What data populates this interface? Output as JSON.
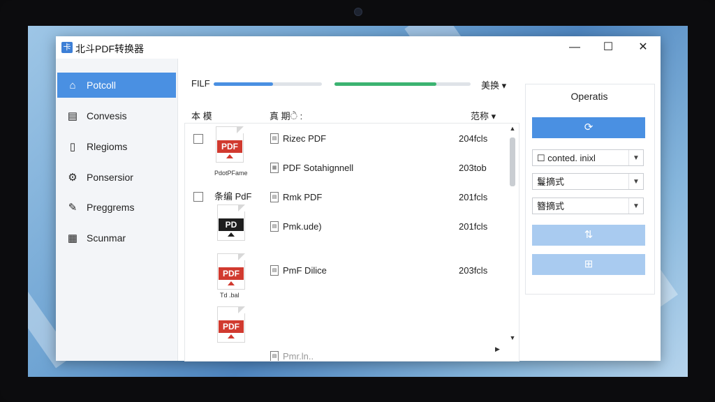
{
  "window": {
    "title": "北斗PDF转换器",
    "logo_glyph": "卡",
    "minimize": "—",
    "maximize": "☐",
    "close": "✕"
  },
  "sidebar": {
    "items": [
      {
        "label": "Potcoll",
        "icon": "home-icon",
        "active": true
      },
      {
        "label": "Convesis",
        "icon": "document-icon"
      },
      {
        "label": "Rlegioms",
        "icon": "file-icon"
      },
      {
        "label": "Ponsersior",
        "icon": "gear-icon"
      },
      {
        "label": "Preggrems",
        "icon": "file-edit-icon"
      },
      {
        "label": "Scunmar",
        "icon": "scan-icon"
      }
    ]
  },
  "toolbar": {
    "label": "FILF",
    "progress_blue": 0.55,
    "progress_green": 0.75,
    "sort_label": "美换 ▾"
  },
  "columns": {
    "col1": "本 模",
    "col2": "真 期ੇ :",
    "col3": "范称 ▾"
  },
  "files": [
    {
      "name": "Rizec PDF",
      "size": "204fcls"
    },
    {
      "name": "PDF Sotahignnell",
      "size": "203tob"
    },
    {
      "name": "Rmk PDF",
      "size": "201fcls"
    },
    {
      "name": "Pmk.ude)",
      "size": "201fcls"
    },
    {
      "name": "PmF Dilice",
      "size": "203fcls"
    },
    {
      "name": "Pmr.ln..",
      "size": ""
    }
  ],
  "thumbs": [
    {
      "badge": "PDF",
      "caption": "PdotPFame"
    },
    {
      "badge": "PD",
      "caption": ""
    },
    {
      "badge": "PDF",
      "caption": "Td .bal"
    },
    {
      "badge": "PDF",
      "caption": ""
    }
  ],
  "row2_label": "条编 PdF",
  "operations": {
    "title": "Operatis",
    "btn1_icon": "⟳",
    "select1": "conted. inixl",
    "select2": "鬘摘式",
    "select3": "簪摘式",
    "btn2_icon": "⇅",
    "btn3_icon": "⊞"
  },
  "colors": {
    "accent": "#4a90e2",
    "green": "#3cb371",
    "pdf_red": "#d13a2f"
  }
}
